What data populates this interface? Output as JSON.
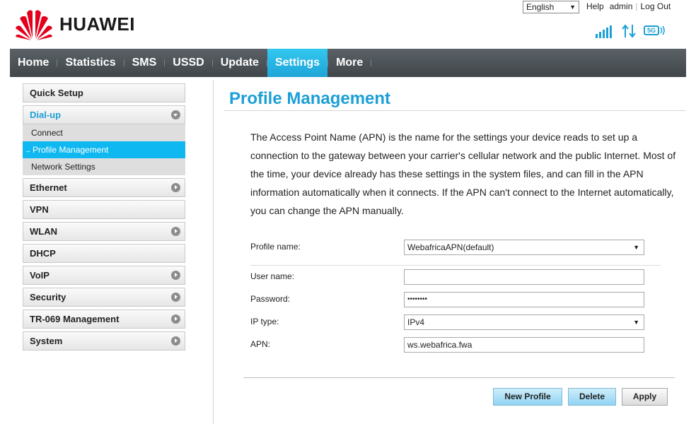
{
  "header": {
    "brand": "HUAWEI",
    "language": "English",
    "links": [
      "Help",
      "admin",
      "Log Out"
    ],
    "network_badge": "5G",
    "colors": {
      "logo_red": "#e3001b",
      "accent": "#1c9fd6",
      "signal": "#1c9fd6"
    }
  },
  "nav": {
    "items": [
      "Home",
      "Statistics",
      "SMS",
      "USSD",
      "Update",
      "Settings",
      "More"
    ],
    "active": "Settings"
  },
  "sidebar": {
    "quick_setup": "Quick Setup",
    "dialup": "Dial-up",
    "dialup_sub": [
      "Connect",
      "Profile Management",
      "Network Settings"
    ],
    "ethernet": "Ethernet",
    "vpn": "VPN",
    "wlan": "WLAN",
    "dhcp": "DHCP",
    "voip": "VoIP",
    "security": "Security",
    "tr069": "TR-069 Management",
    "system": "System"
  },
  "main": {
    "title": "Profile Management",
    "description": "The Access Point Name (APN) is the name for the settings your device reads to set up a connection to the gateway between your carrier's cellular network and the public Internet. Most of the time, your device already has these settings in the system files, and can fill in the APN information automatically when it connects. If the APN can't connect to the Internet automatically, you can change the APN manually.",
    "form": {
      "profile_name_label": "Profile name:",
      "profile_name_value": "WebafricaAPN(default)",
      "user_name_label": "User name:",
      "user_name_value": "",
      "password_label": "Password:",
      "password_value": "••••••••",
      "ip_type_label": "IP type:",
      "ip_type_value": "IPv4",
      "apn_label": "APN:",
      "apn_value": "ws.webafrica.fwa"
    },
    "buttons": {
      "new_profile": "New Profile",
      "delete": "Delete",
      "apply": "Apply"
    }
  }
}
